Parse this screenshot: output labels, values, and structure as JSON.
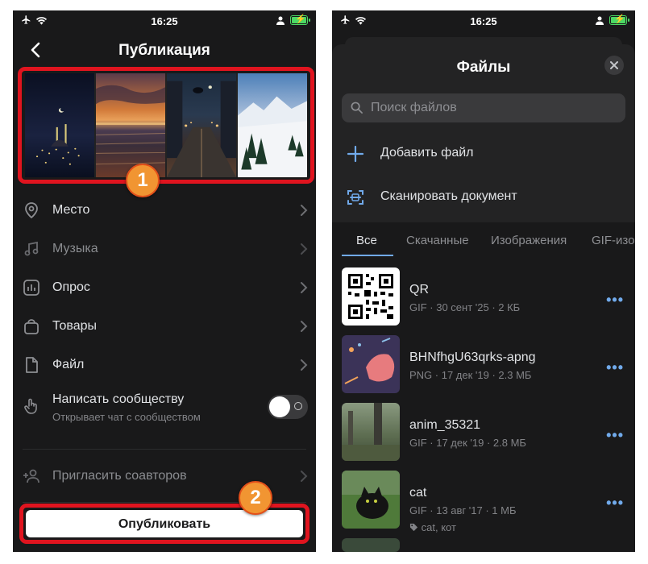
{
  "status_bar": {
    "time": "16:25"
  },
  "left": {
    "title": "Публикация",
    "badge1": "1",
    "badge2": "2",
    "rows": [
      {
        "label": "Место",
        "icon": "location-pin-icon"
      },
      {
        "label": "Музыка",
        "icon": "music-note-icon"
      },
      {
        "label": "Опрос",
        "icon": "poll-icon"
      },
      {
        "label": "Товары",
        "icon": "shopping-bag-icon"
      },
      {
        "label": "Файл",
        "icon": "file-icon"
      }
    ],
    "community": {
      "label": "Написать сообществу",
      "subtitle": "Открывает чат с сообществом",
      "toggle_on": false
    },
    "invite": {
      "label": "Пригласить соавторов"
    },
    "publish_label": "Опубликовать",
    "accent_red": "#e0141f",
    "badge_color": "#f19532"
  },
  "right": {
    "title": "Файлы",
    "search_placeholder": "Поиск файлов",
    "actions": [
      {
        "label": "Добавить файл",
        "icon": "plus-icon"
      },
      {
        "label": "Сканировать документ",
        "icon": "scan-document-icon"
      }
    ],
    "tabs": [
      "Все",
      "Скачанные",
      "Изображения",
      "GIF-изо"
    ],
    "active_tab": "Все",
    "files": [
      {
        "name": "QR",
        "meta": "GIF · 30 сент '25 · 2 КБ",
        "tag": ""
      },
      {
        "name": "BHNfhgU63qrks-apng",
        "meta": "PNG · 17 дек '19 · 2.3 МБ",
        "tag": ""
      },
      {
        "name": "anim_35321",
        "meta": "GIF · 17 дек '19 · 2.8 МБ",
        "tag": ""
      },
      {
        "name": "cat",
        "meta": "GIF · 13 авг '17 · 1 МБ",
        "tag": "cat, кот"
      }
    ],
    "more_glyph": "•••",
    "accent_blue": "#71aaeb"
  }
}
